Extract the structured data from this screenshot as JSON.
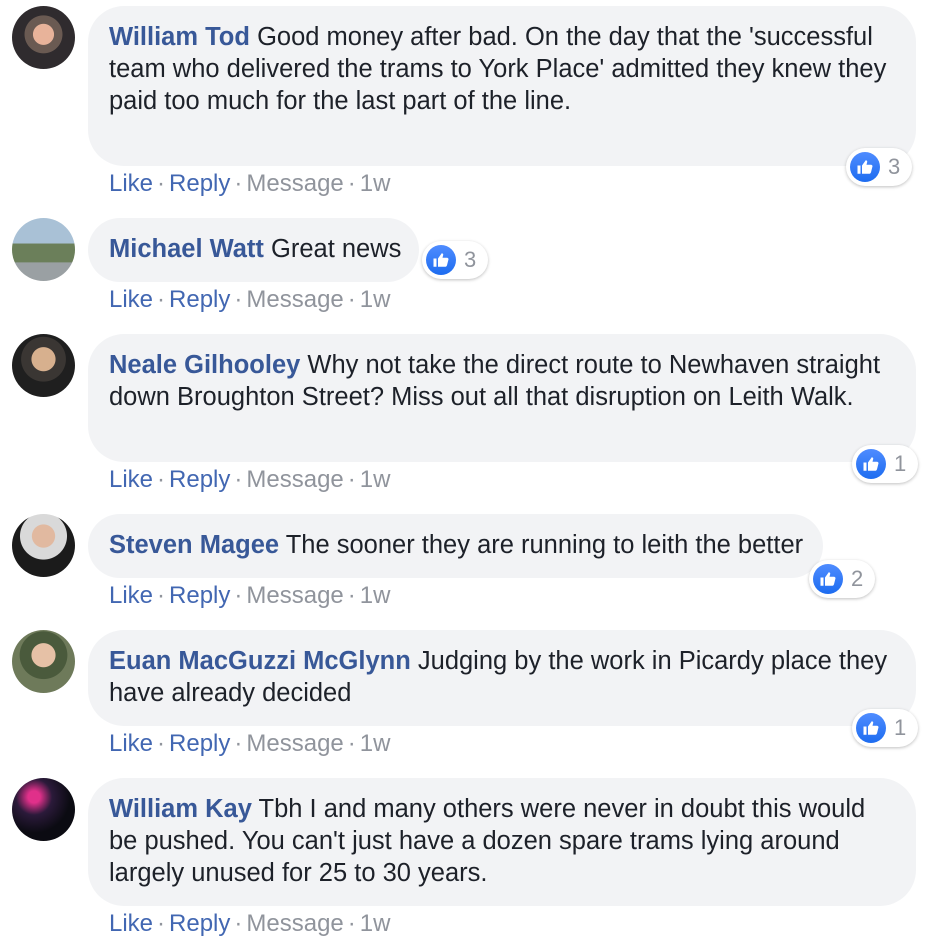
{
  "comments": [
    {
      "author": "William Tod",
      "text": "Good money after bad. On the day that the 'successful team who delivered the trams to York Place' admitted they knew they paid too much for the last part of the line.",
      "reactions": "3",
      "actions": {
        "like": "Like",
        "reply": "Reply",
        "message": "Message",
        "time": "1w"
      }
    },
    {
      "author": "Michael Watt",
      "text": "Great news",
      "reactions": "3",
      "actions": {
        "like": "Like",
        "reply": "Reply",
        "message": "Message",
        "time": "1w"
      }
    },
    {
      "author": "Neale Gilhooley",
      "text": "Why not take the direct route to Newhaven straight down Broughton Street? Miss out all that disruption on Leith Walk.",
      "reactions": "1",
      "actions": {
        "like": "Like",
        "reply": "Reply",
        "message": "Message",
        "time": "1w"
      }
    },
    {
      "author": "Steven Magee",
      "text": "The sooner they are running to leith the better",
      "reactions": "2",
      "actions": {
        "like": "Like",
        "reply": "Reply",
        "message": "Message",
        "time": "1w"
      }
    },
    {
      "author": "Euan MacGuzzi McGlynn",
      "text": "Judging by the work in Picardy place they have already decided",
      "reactions": "1",
      "actions": {
        "like": "Like",
        "reply": "Reply",
        "message": "Message",
        "time": "1w"
      }
    },
    {
      "author": "William Kay",
      "text": "Tbh I and many others were never in doubt this would be pushed. You can't just have a dozen spare trams lying around largely unused for 25 to 30 years.",
      "reactions": "",
      "actions": {
        "like": "Like",
        "reply": "Reply",
        "message": "Message",
        "time": "1w"
      }
    }
  ],
  "colors": {
    "author": "#385898",
    "link": "#4267b2",
    "muted": "#90949c",
    "bubble": "#f2f3f5",
    "like_icon": "#1d6cf0"
  }
}
